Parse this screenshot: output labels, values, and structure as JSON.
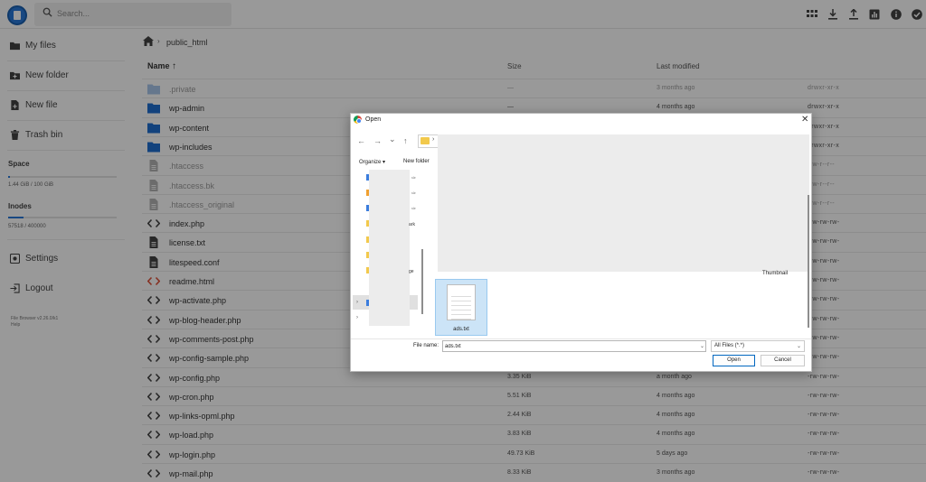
{
  "header": {
    "search_placeholder": "Search...",
    "icons": [
      "grid-view-icon",
      "download-icon",
      "upload-icon",
      "usage-chart-icon",
      "info-icon",
      "select-icon"
    ]
  },
  "sidebar": {
    "items": [
      {
        "label": "My files",
        "icon": "folder-icon"
      },
      {
        "label": "New folder",
        "icon": "new-folder-icon"
      },
      {
        "label": "New file",
        "icon": "new-file-icon"
      },
      {
        "label": "Trash bin",
        "icon": "trash-icon"
      }
    ],
    "space": {
      "title": "Space",
      "value": "1.44 GiB / 100 GiB",
      "fraction": 0.0144
    },
    "inodes": {
      "title": "Inodes",
      "value": "57518 / 400000",
      "fraction": 0.144
    },
    "settings_label": "Settings",
    "logout_label": "Logout",
    "version": "File Browser v2.26.0/k1",
    "help": "Help"
  },
  "breadcrumb": {
    "current": "public_html"
  },
  "listing": {
    "columns": {
      "name": "Name",
      "size": "Size",
      "modified": "Last modified"
    },
    "rows": [
      {
        "name": ".private",
        "size": "—",
        "modified": "3 months ago",
        "perm": "drwxr-xr-x",
        "icon": "folder-icon",
        "faded": true
      },
      {
        "name": "wp-admin",
        "size": "—",
        "modified": "4 months ago",
        "perm": "drwxr-xr-x",
        "icon": "folder-icon",
        "faded": false
      },
      {
        "name": "wp-content",
        "size": "",
        "modified": "",
        "perm": "drwxr-xr-x",
        "icon": "folder-icon",
        "faded": false
      },
      {
        "name": "wp-includes",
        "size": "",
        "modified": "",
        "perm": "drwxr-xr-x",
        "icon": "folder-icon",
        "faded": false
      },
      {
        "name": ".htaccess",
        "size": "",
        "modified": "",
        "perm": "-rw-r--r--",
        "icon": "document-icon",
        "faded": true
      },
      {
        "name": ".htaccess.bk",
        "size": "",
        "modified": "",
        "perm": "-rw-r--r--",
        "icon": "document-icon",
        "faded": true
      },
      {
        "name": ".htaccess_original",
        "size": "",
        "modified": "",
        "perm": "-rw-r--r--",
        "icon": "document-icon",
        "faded": true
      },
      {
        "name": "index.php",
        "size": "",
        "modified": "",
        "perm": "-rw-rw-rw-",
        "icon": "code-icon",
        "faded": false
      },
      {
        "name": "license.txt",
        "size": "",
        "modified": "",
        "perm": "-rw-rw-rw-",
        "icon": "document-icon",
        "faded": false
      },
      {
        "name": "litespeed.conf",
        "size": "",
        "modified": "",
        "perm": "-rw-rw-rw-",
        "icon": "document-icon",
        "faded": false
      },
      {
        "name": "readme.html",
        "size": "",
        "modified": "",
        "perm": "-rw-rw-rw-",
        "icon": "html-code-icon",
        "faded": false
      },
      {
        "name": "wp-activate.php",
        "size": "",
        "modified": "",
        "perm": "-rw-rw-rw-",
        "icon": "code-icon",
        "faded": false
      },
      {
        "name": "wp-blog-header.php",
        "size": "",
        "modified": "",
        "perm": "-rw-rw-rw-",
        "icon": "code-icon",
        "faded": false
      },
      {
        "name": "wp-comments-post.php",
        "size": "",
        "modified": "",
        "perm": "-rw-rw-rw-",
        "icon": "code-icon",
        "faded": false
      },
      {
        "name": "wp-config-sample.php",
        "size": "",
        "modified": "",
        "perm": "-rw-rw-rw-",
        "icon": "code-icon",
        "faded": false
      },
      {
        "name": "wp-config.php",
        "size": "3.35 KiB",
        "modified": "a month ago",
        "perm": "-rw-rw-rw-",
        "icon": "code-icon",
        "faded": false
      },
      {
        "name": "wp-cron.php",
        "size": "5.51 KiB",
        "modified": "4 months ago",
        "perm": "-rw-rw-rw-",
        "icon": "code-icon",
        "faded": false
      },
      {
        "name": "wp-links-opml.php",
        "size": "2.44 KiB",
        "modified": "4 months ago",
        "perm": "-rw-rw-rw-",
        "icon": "code-icon",
        "faded": false
      },
      {
        "name": "wp-load.php",
        "size": "3.83 KiB",
        "modified": "4 months ago",
        "perm": "-rw-rw-rw-",
        "icon": "code-icon",
        "faded": false
      },
      {
        "name": "wp-login.php",
        "size": "49.73 KiB",
        "modified": "5 days ago",
        "perm": "-rw-rw-rw-",
        "icon": "code-icon",
        "faded": false
      },
      {
        "name": "wp-mail.php",
        "size": "8.33 KiB",
        "modified": "3 months ago",
        "perm": "-rw-rw-rw-",
        "icon": "code-icon",
        "faded": false
      }
    ]
  },
  "dialog": {
    "title": "Open",
    "close": "✕",
    "nav": {
      "back": "←",
      "forward": "→",
      "recent": "⌄",
      "up": "↑"
    },
    "organize_label": "Organize ▾",
    "new_folder_label": "New folder",
    "nav_pane_fragments": [
      "ark",
      "ge"
    ],
    "thumbnail_label": "Thumbnail",
    "selected_file": "ads.txt",
    "file_name_label": "File name:",
    "file_name_value": "ads.txt",
    "filter_value": "All Files (*.*)",
    "open_label": "Open",
    "cancel_label": "Cancel"
  },
  "colors": {
    "accent": "#2979d9",
    "folder": "#1f6fd1",
    "dialog_selection": "#cce4f7"
  }
}
